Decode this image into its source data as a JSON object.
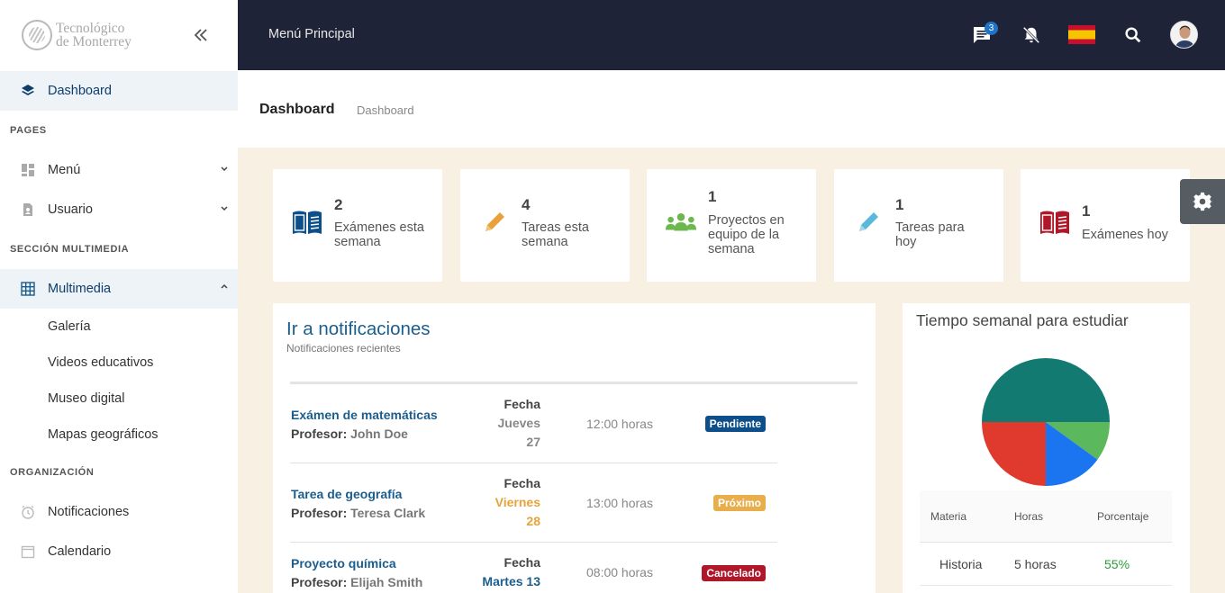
{
  "logo": {
    "line1": "Tecnológico",
    "line2": "de Monterrey"
  },
  "sidebar": {
    "dashboard": "Dashboard",
    "pages_title": "PAGES",
    "menu": "Menú",
    "usuario": "Usuario",
    "multimedia_title": "SECCIÓN MULTIMEDIA",
    "multimedia": "Multimedia",
    "sub": [
      "Galería",
      "Videos educativos",
      "Museo digital",
      "Mapas geográficos"
    ],
    "org_title": "ORGANIZACIÓN",
    "notificaciones": "Notificaciones",
    "calendario": "Calendario"
  },
  "topbar": {
    "title": "Menú Principal",
    "message_count": "3"
  },
  "header": {
    "title": "Dashboard",
    "breadcrumb": "Dashboard"
  },
  "stats": [
    {
      "value": "1",
      "label": "Exámenes hoy"
    }
  ],
  "stat_cards": {
    "examenes_semana": {
      "value": "2",
      "label1": "Exámenes esta",
      "label2": "semana"
    },
    "tareas_semana": {
      "value": "4",
      "label1": "Tareas esta",
      "label2": "semana"
    },
    "proyectos": {
      "value": "1",
      "label1": "Proyectos en",
      "label2": "equipo de la",
      "label3": "semana"
    },
    "tareas_hoy": {
      "value": "1",
      "label1": "Tareas para",
      "label2": "hoy"
    },
    "examenes_hoy": {
      "value": "1",
      "label1": "Exámenes hoy"
    }
  },
  "notifications": {
    "title": "Ir a notificaciones",
    "subtitle": "Notificaciones recientes",
    "rows": [
      {
        "title": "Exámen de matemáticas",
        "prof_label": "Profesor:",
        "prof": "John Doe",
        "fecha": "Fecha",
        "date1": "Jueves",
        "date2": "27",
        "time": "12:00 horas",
        "status": "Pendiente"
      },
      {
        "title": "Tarea de geografía",
        "prof_label": "Profesor:",
        "prof": "Teresa Clark",
        "fecha": "Fecha",
        "date1": "Viernes",
        "date2": "28",
        "time": "13:00 horas",
        "status": "Próximo"
      },
      {
        "title": "Proyecto química",
        "prof_label": "Profesor:",
        "prof": "Elijah Smith",
        "fecha": "Fecha",
        "date1": "Martes 13",
        "date2": "",
        "time": "08:00 horas",
        "status": "Cancelado"
      }
    ]
  },
  "colors": {
    "pendiente": "#0d4f8b",
    "proximo": "#e8ae4c",
    "cancelado": "#b0182a",
    "jueves": "#888888",
    "viernes": "#e8a23c",
    "martes": "#1b5e8e"
  },
  "study": {
    "title": "Tiempo semanal para estudiar",
    "headers": [
      "Materia",
      "Horas",
      "Porcentaje"
    ],
    "rows": [
      {
        "materia": "Historia",
        "horas": "5 horas",
        "pct": "55%"
      }
    ]
  },
  "chart_data": {
    "type": "pie",
    "title": "Tiempo semanal para estudiar",
    "slices": [
      {
        "value": 50,
        "color": "#137a72"
      },
      {
        "value": 10,
        "color": "#5cb85c"
      },
      {
        "value": 15,
        "color": "#1b75f0"
      },
      {
        "value": 25,
        "color": "#e0392e"
      }
    ]
  }
}
